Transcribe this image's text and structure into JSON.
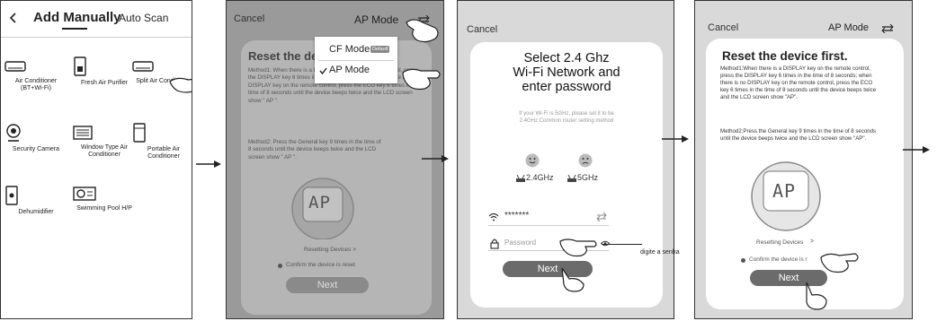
{
  "screen1": {
    "back_icon": "chevron-left-icon",
    "tab_manual": "Add Manually",
    "tab_auto": "Auto Scan",
    "devices": [
      {
        "label": "Air Conditioner (BT+Wi-Fi)",
        "icon": "ac-icon"
      },
      {
        "label": "Fresh Air Purifier",
        "icon": "purifier-icon"
      },
      {
        "label": "Split Air Conditioner",
        "icon": "split-ac-icon"
      },
      {
        "label": "Security Camera",
        "icon": "camera-icon"
      },
      {
        "label": "Window Type Air Conditioner",
        "icon": "window-ac-icon"
      },
      {
        "label": "Portable Air Conditioner",
        "icon": "portable-ac-icon"
      },
      {
        "label": "Dehumidifier",
        "icon": "dehumidifier-icon"
      },
      {
        "label": "Swimming Pool H/P",
        "icon": "pool-hp-icon"
      }
    ]
  },
  "screen2": {
    "cancel": "Cancel",
    "mode": "AP Mode",
    "title": "Reset the de",
    "method1": "Method1: When there is a DISPLAY key on the remote control, press the DISPLAY key 6 times in the time of 8 seconds; when there is no DISPLAY key on the remote control, press the ECO key 6 times in the time of 8 seconds until the device beeps twice and the LCD screen show \" AP \".",
    "method2": "Method2: Press the General key 9 times in the time of 8 seconds until the device beeps twice and the LCD screen show \" AP \".",
    "display": "AP",
    "resetting": "Resetting Devices >",
    "confirm": "Confirm the device is reset",
    "next": "Next",
    "dropdown": {
      "cf_mode": "CF Mode",
      "cf_badge": "Default",
      "ap_mode": "AP Mode"
    }
  },
  "screen3": {
    "cancel": "Cancel",
    "title_l1": "Select 2.4 Ghz",
    "title_l2": "Wi-Fi Network and",
    "title_l3": "enter password",
    "hint": "If your Wi-Fi is 5GHz, please set it to be 2.4GHz.Common router setting method",
    "band_24": "2.4GHz",
    "band_5": "5GHz",
    "ssid_value": "*******",
    "password_placeholder": "Password",
    "next": "Next",
    "annotation": "digite a senha"
  },
  "screen4": {
    "cancel": "Cancel",
    "mode": "AP Mode",
    "title": "Reset the device first.",
    "method1": "Method1:When there is a DISPLAY key on the remote control, press the DISPLAY key 6 times in the time of 8 seconds; when there is no DISPLAY key on the remote control, press the ECO key 6 times in the time of 8 seconds until the device beeps twice and the LCD screen show \"AP\".",
    "method2": "Method2:Press the General key 9 times in the time of 8 seconds until the device beeps twice and the LCD screen show \"AP\".",
    "display": "AP",
    "resetting": "Resetting Devices",
    "resetting_chevron": ">",
    "confirm": "Confirm the device is r",
    "next": "Next"
  }
}
